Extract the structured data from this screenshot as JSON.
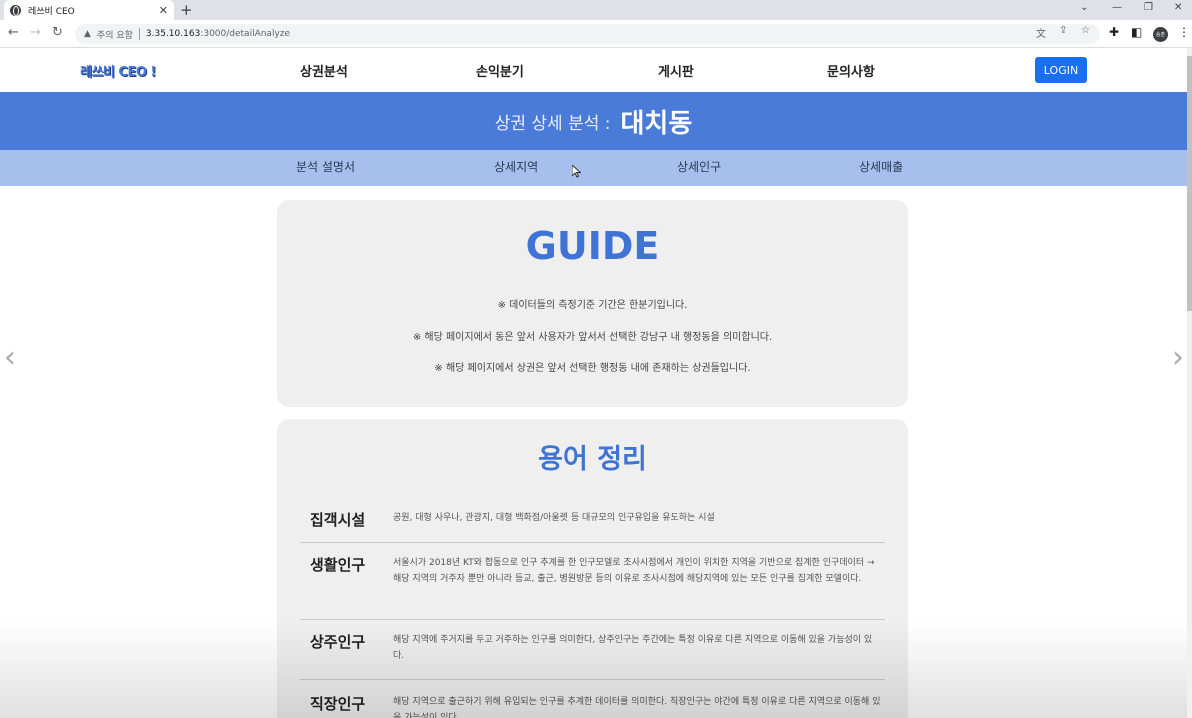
{
  "browser": {
    "tab_title": "레쓰비 CEO",
    "tab_close": "✕",
    "new_tab": "+",
    "security_warning": "주의 요함",
    "url_host": "3.35.10.163",
    "url_path": ":3000/detailAnalyze",
    "window_controls": [
      "⌄",
      "—",
      "❐",
      "✕"
    ],
    "profile_initials": "승훈"
  },
  "header": {
    "logo": "레쓰비 CEO !",
    "nav": [
      "상권분석",
      "손익분기",
      "게시판",
      "문의사항"
    ],
    "login_label": "LOGIN"
  },
  "hero": {
    "prefix": "상권 상세 분석 :",
    "district": "대치동"
  },
  "subnav": [
    "분석 설명서",
    "상세지역",
    "상세인구",
    "상세매출"
  ],
  "guide": {
    "title": "GUIDE",
    "lines": [
      "※ 데이터들의 측정기준 기간은 한분기입니다.",
      "※ 해당 페이지에서 동은 앞서 사용자가 앞서서 선택한 강남구 내 행정동을 의미합니다.",
      "※ 해당 페이지에서 상권은 앞서 선택한 행정동 내에 존재하는 상권들입니다."
    ]
  },
  "terms": {
    "title": "용어 정리",
    "items": [
      {
        "name": "집객시설",
        "desc": "공원, 대형 사우나, 관광지, 대형 백화점/아울렛 등 대규모의 인구유입을 유도하는 시설"
      },
      {
        "name": "생활인구",
        "desc": "서울시가 2018년 KT와 합동으로 인구 추계를 한 인구모델로 조사시점에서 개인이 위치한 지역을 기반으로 집계한 인구데이터 → 해당 지역의 거주자 뿐만 아니라 등교, 출근, 병원방문 등의 이유로 조사시점에 해당지역에 있는 모든 인구를 집계한 모델이다."
      },
      {
        "name": "상주인구",
        "desc": "해당 지역에 주거지를 두고 거주하는 인구를 의미한다, 상주인구는 주간에는 특정 이유로 다른 지역으로 이동해 있을 가능성이 있다."
      },
      {
        "name": "직장인구",
        "desc": "해당 지역으로 출근하기 위해 유입되는 인구를 추계한 데이터를 의미한다. 직장인구는 야간에 특정 이유로 다른 지역으로 이동해 있을 가능성이 있다."
      }
    ]
  },
  "side_arrows": {
    "left": "‹",
    "right": "›"
  }
}
